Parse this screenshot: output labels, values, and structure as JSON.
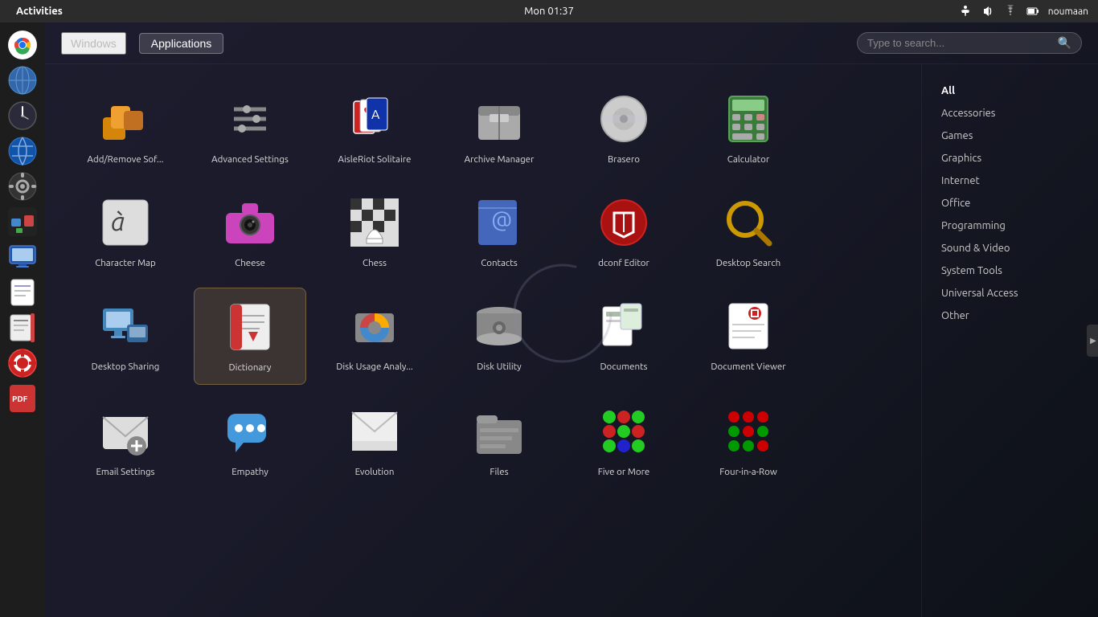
{
  "topbar": {
    "activities": "Activities",
    "clock": "Mon 01:37",
    "username": "noumaan"
  },
  "header": {
    "windows_label": "Windows",
    "applications_label": "Applications",
    "search_placeholder": "Type to search..."
  },
  "categories": [
    {
      "id": "all",
      "label": "All",
      "active": true
    },
    {
      "id": "accessories",
      "label": "Accessories",
      "active": false
    },
    {
      "id": "games",
      "label": "Games",
      "active": false
    },
    {
      "id": "graphics",
      "label": "Graphics",
      "active": false
    },
    {
      "id": "internet",
      "label": "Internet",
      "active": false
    },
    {
      "id": "office",
      "label": "Office",
      "active": false
    },
    {
      "id": "programming",
      "label": "Programming",
      "active": false
    },
    {
      "id": "sound-video",
      "label": "Sound & Video",
      "active": false
    },
    {
      "id": "system-tools",
      "label": "System Tools",
      "active": false
    },
    {
      "id": "universal-access",
      "label": "Universal Access",
      "active": false
    },
    {
      "id": "other",
      "label": "Other",
      "active": false
    }
  ],
  "apps": [
    {
      "id": "add-remove",
      "name": "Add/Remove Sof...",
      "color1": "#d4850a",
      "color2": "#f0a030",
      "type": "packages"
    },
    {
      "id": "advanced-settings",
      "name": "Advanced Settings",
      "color1": "#888",
      "color2": "#aaa",
      "type": "settings"
    },
    {
      "id": "aisleriot",
      "name": "AisleRiot Solitaire",
      "color1": "#2244aa",
      "color2": "#3366cc",
      "type": "cards"
    },
    {
      "id": "archive-manager",
      "name": "Archive Manager",
      "color1": "#888",
      "color2": "#bbb",
      "type": "archive"
    },
    {
      "id": "brasero",
      "name": "Brasero",
      "color1": "#aaa",
      "color2": "#ccc",
      "type": "disc"
    },
    {
      "id": "calculator",
      "name": "Calculator",
      "color1": "#3a7a3a",
      "color2": "#5aa05a",
      "type": "calculator"
    },
    {
      "id": "character-map",
      "name": "Character Map",
      "color1": "#999",
      "color2": "#bbb",
      "type": "charmap"
    },
    {
      "id": "cheese",
      "name": "Cheese",
      "color1": "#aa44aa",
      "color2": "#cc66cc",
      "type": "webcam"
    },
    {
      "id": "chess",
      "name": "Chess",
      "color1": "#888",
      "color2": "#aaa",
      "type": "chess"
    },
    {
      "id": "contacts",
      "name": "Contacts",
      "color1": "#334488",
      "color2": "#4466aa",
      "type": "contacts"
    },
    {
      "id": "dconf-editor",
      "name": "dconf Editor",
      "color1": "#880000",
      "color2": "#aa2222",
      "type": "dconf"
    },
    {
      "id": "desktop-search",
      "name": "Desktop Search",
      "color1": "#aa7700",
      "color2": "#cc9900",
      "type": "search"
    },
    {
      "id": "desktop-sharing",
      "name": "Desktop Sharing",
      "color1": "#336699",
      "color2": "#4488bb",
      "type": "sharing"
    },
    {
      "id": "dictionary",
      "name": "Dictionary",
      "color1": "#cc3333",
      "color2": "#ee4444",
      "type": "book",
      "selected": true
    },
    {
      "id": "disk-usage",
      "name": "Disk Usage Analy...",
      "color1": "#887700",
      "color2": "#aa9900",
      "type": "diskusage"
    },
    {
      "id": "disk-utility",
      "name": "Disk Utility",
      "color1": "#777",
      "color2": "#999",
      "type": "disk"
    },
    {
      "id": "documents",
      "name": "Documents",
      "color1": "#557733",
      "color2": "#779944",
      "type": "documents"
    },
    {
      "id": "document-viewer",
      "name": "Document Viewer",
      "color1": "#cc2222",
      "color2": "#ee3333",
      "type": "viewer"
    },
    {
      "id": "email-settings",
      "name": "Email Settings",
      "color1": "#aaa",
      "color2": "#ccc",
      "type": "email"
    },
    {
      "id": "empathy",
      "name": "Empathy",
      "color1": "#3388cc",
      "color2": "#55aaee",
      "type": "chat"
    },
    {
      "id": "evolution",
      "name": "Evolution",
      "color1": "#aaa",
      "color2": "#ccc",
      "type": "evolution"
    },
    {
      "id": "files",
      "name": "Files",
      "color1": "#666",
      "color2": "#888",
      "type": "files"
    },
    {
      "id": "five-or-more",
      "name": "Five or More",
      "color1": "#3a3",
      "color2": "#5c5",
      "type": "game-five"
    },
    {
      "id": "four-in-row",
      "name": "Four-in-a-Row",
      "color1": "#cc0000",
      "color2": "#ee0000",
      "type": "game-four"
    }
  ]
}
